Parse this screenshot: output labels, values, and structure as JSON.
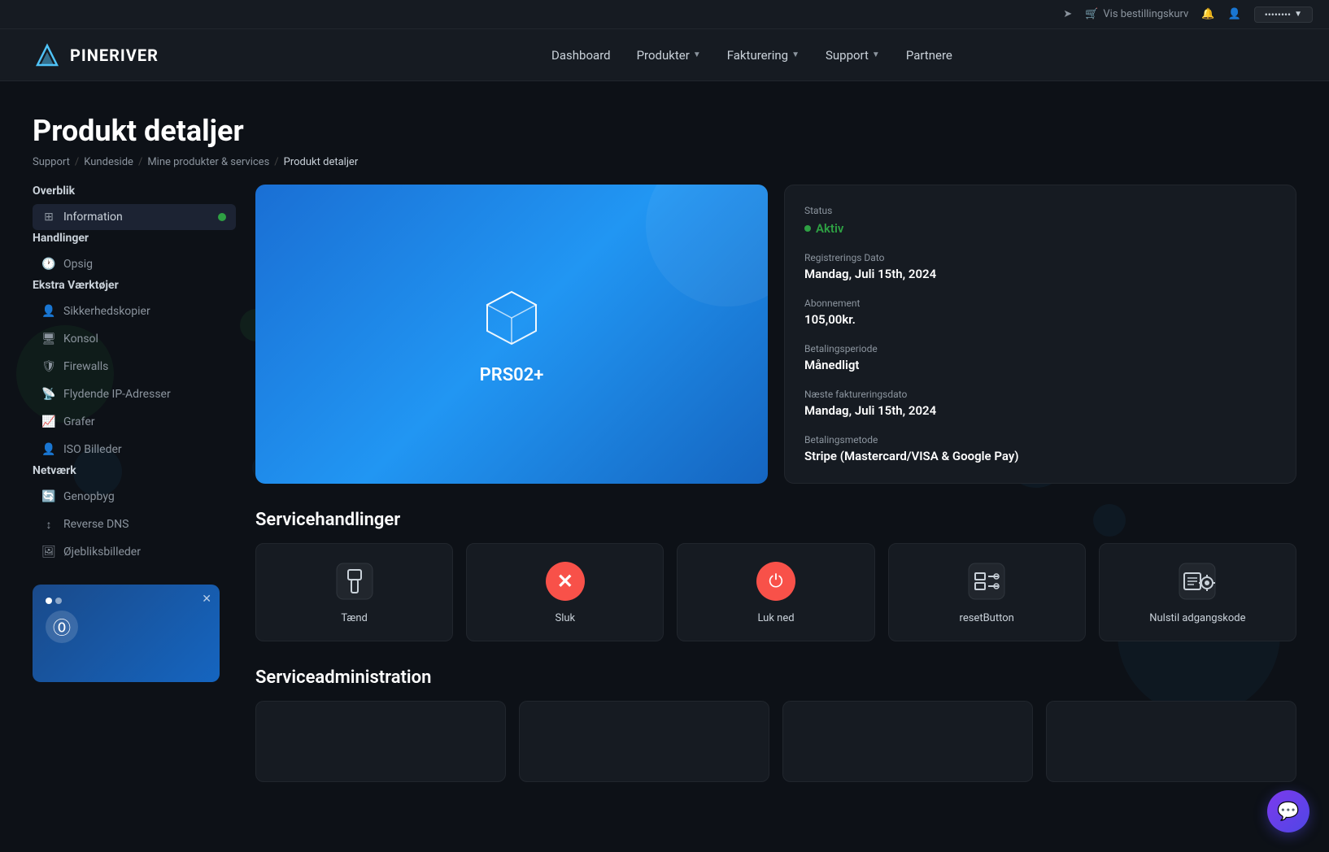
{
  "topbar": {
    "cart_label": "Vis bestillingskurv",
    "user_label": "••••••••"
  },
  "nav": {
    "logo_text": "PINERIVER",
    "items": [
      {
        "label": "Dashboard",
        "has_dropdown": false
      },
      {
        "label": "Produkter",
        "has_dropdown": true
      },
      {
        "label": "Fakturering",
        "has_dropdown": true
      },
      {
        "label": "Support",
        "has_dropdown": true
      },
      {
        "label": "Partnere",
        "has_dropdown": false
      }
    ]
  },
  "page": {
    "title": "Produkt detaljer",
    "breadcrumb": [
      {
        "label": "Support",
        "is_current": false
      },
      {
        "label": "Kundeside",
        "is_current": false
      },
      {
        "label": "Mine produkter & services",
        "is_current": false
      },
      {
        "label": "Produkt detaljer",
        "is_current": true
      }
    ]
  },
  "sidebar": {
    "sections": [
      {
        "title": "Overblik",
        "items": [
          {
            "label": "Information",
            "icon": "grid",
            "active": true,
            "badge": true
          }
        ]
      },
      {
        "title": "Handlinger",
        "items": [
          {
            "label": "Opsig",
            "icon": "clock",
            "active": false
          }
        ]
      },
      {
        "title": "Ekstra Værktøjer",
        "items": [
          {
            "label": "Sikkerhedskopier",
            "icon": "user-backup",
            "active": false
          },
          {
            "label": "Konsol",
            "icon": "monitor",
            "active": false
          },
          {
            "label": "Firewalls",
            "icon": "shield",
            "active": false
          },
          {
            "label": "Flydende IP-Adresser",
            "icon": "rss",
            "active": false
          },
          {
            "label": "Grafer",
            "icon": "chart",
            "active": false
          },
          {
            "label": "ISO Billeder",
            "icon": "user-iso",
            "active": false
          }
        ]
      },
      {
        "title": "Netværk",
        "items": [
          {
            "label": "Genopbyg",
            "icon": "refresh",
            "active": false
          },
          {
            "label": "Reverse DNS",
            "icon": "sort",
            "active": false
          },
          {
            "label": "Øjebliksbilleder",
            "icon": "photo",
            "active": false
          }
        ]
      }
    ]
  },
  "product": {
    "name": "PRS02+",
    "status": "Aktiv",
    "registration_date_label": "Registrerings Dato",
    "registration_date": "Mandag, Juli 15th, 2024",
    "subscription_label": "Abonnement",
    "subscription": "105,00kr.",
    "payment_period_label": "Betalingsperiode",
    "payment_period": "Månedligt",
    "next_billing_label": "Næste faktureringsdato",
    "next_billing": "Mandag, Juli 15th, 2024",
    "payment_method_label": "Betalingsmetode",
    "payment_method": "Stripe (Mastercard/VISA & Google Pay)"
  },
  "service_actions": {
    "title": "Servicehandlinger",
    "actions": [
      {
        "label": "Tænd",
        "icon": "power-on"
      },
      {
        "label": "Sluk",
        "icon": "stop-red"
      },
      {
        "label": "Luk ned",
        "icon": "power-red"
      },
      {
        "label": "resetButton",
        "icon": "reset"
      },
      {
        "label": "Nulstil adgangskode",
        "icon": "key-settings"
      }
    ]
  },
  "service_admin": {
    "title": "Serviceadministration"
  },
  "mini_card": {
    "visible": true
  }
}
